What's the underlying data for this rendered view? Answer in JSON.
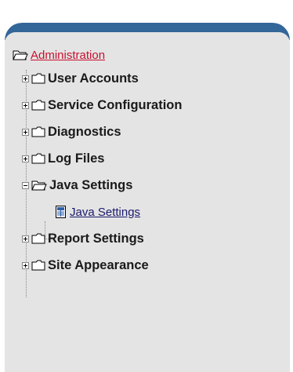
{
  "tree": {
    "root": {
      "label": "Administration",
      "icon": "folder-open-icon",
      "color": "#c8102e"
    },
    "items": [
      {
        "label": "User Accounts",
        "state": "collapsed",
        "icon": "folder-icon"
      },
      {
        "label": "Service Configuration",
        "state": "collapsed",
        "icon": "folder-icon"
      },
      {
        "label": "Diagnostics",
        "state": "collapsed",
        "icon": "folder-icon"
      },
      {
        "label": "Log Files",
        "state": "collapsed",
        "icon": "folder-icon"
      },
      {
        "label": "Java Settings",
        "state": "expanded",
        "icon": "folder-open-icon",
        "children": [
          {
            "label": "Java Settings",
            "icon": "page-icon"
          }
        ]
      },
      {
        "label": "Report Settings",
        "state": "collapsed",
        "icon": "folder-icon"
      },
      {
        "label": "Site Appearance",
        "state": "collapsed",
        "icon": "folder-icon"
      }
    ]
  },
  "colors": {
    "header": "#336699",
    "panel": "#e4e4e4",
    "leaf_link": "#1a1a6e"
  }
}
